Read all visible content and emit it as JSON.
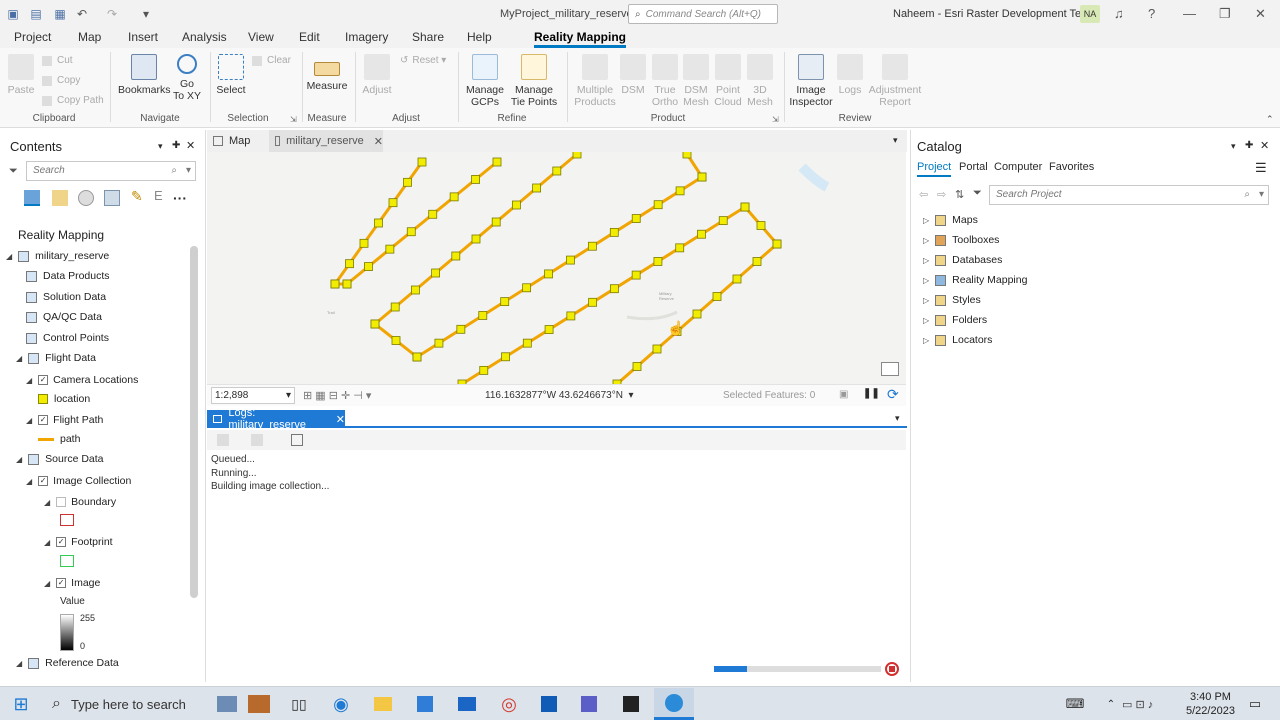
{
  "window": {
    "title": "MyProject_military_reserve",
    "command_search": "Command Search (Alt+Q)",
    "user": "Naheem - Esri Raster Development Team",
    "avatar": "NA"
  },
  "ribbon_tabs": [
    "Project",
    "Map",
    "Insert",
    "Analysis",
    "View",
    "Edit",
    "Imagery",
    "Share",
    "Help",
    "Reality Mapping"
  ],
  "ribbon": {
    "clipboard": {
      "paste": "Paste",
      "cut": "Cut",
      "copy": "Copy",
      "copy_path": "Copy Path",
      "group": "Clipboard"
    },
    "navigate": {
      "bookmarks": "Bookmarks",
      "goto": "Go",
      "goto2": "To XY",
      "group": "Navigate"
    },
    "selection": {
      "select": "Select",
      "clear": "Clear",
      "group": "Selection"
    },
    "measure": {
      "measure": "Measure",
      "group": "Measure"
    },
    "adjust": {
      "adjust": "Adjust",
      "reset": "Reset",
      "group": "Adjust"
    },
    "refine": {
      "gcps1": "Manage",
      "gcps2": "GCPs",
      "tie1": "Manage",
      "tie2": "Tie Points",
      "group": "Refine"
    },
    "product": {
      "multi1": "Multiple",
      "multi2": "Products",
      "dsm": "DSM",
      "ortho1": "True",
      "ortho2": "Ortho",
      "dsmmesh1": "DSM",
      "dsmmesh2": "Mesh",
      "pc1": "Point",
      "pc2": "Cloud",
      "mesh1": "3D",
      "mesh2": "Mesh",
      "group": "Product"
    },
    "review": {
      "inspector1": "Image",
      "inspector2": "Inspector",
      "logs": "Logs",
      "report1": "Adjustment",
      "report2": "Report",
      "group": "Review"
    }
  },
  "contents": {
    "title": "Contents",
    "search": "Search",
    "heading": "Reality Mapping",
    "items": {
      "root": "military_reserve",
      "data_products": "Data Products",
      "solution_data": "Solution Data",
      "qaqc": "QA/QC Data",
      "control_points": "Control Points",
      "flight_data": "Flight Data",
      "camera_locations": "Camera Locations",
      "location": "location",
      "flight_path": "Flight Path",
      "path": "path",
      "source_data": "Source Data",
      "image_collection": "Image Collection",
      "boundary": "Boundary",
      "footprint": "Footprint",
      "image": "Image",
      "value": "Value",
      "high": "255",
      "low": "0",
      "reference_data": "Reference Data"
    }
  },
  "map": {
    "tab_map": "Map",
    "tab_active": "military_reserve",
    "scale": "1:2,898",
    "coords": "116.1632877°W 43.6246673°N",
    "selected": "Selected Features: 0",
    "label": "Military Reserve"
  },
  "logs": {
    "tab": "Logs: military_reserve",
    "lines": [
      "Queued...",
      "Running...",
      "Building image collection..."
    ],
    "progress": 0.2
  },
  "catalog": {
    "title": "Catalog",
    "tabs": [
      "Project",
      "Portal",
      "Computer",
      "Favorites"
    ],
    "search": "Search Project",
    "items": [
      "Maps",
      "Toolboxes",
      "Databases",
      "Reality Mapping",
      "Styles",
      "Folders",
      "Locators"
    ]
  },
  "taskbar": {
    "search": "Type here to search",
    "time": "3:40 PM",
    "date": "5/22/2023"
  },
  "colors": {
    "accent": "#007ac2",
    "flight": "#f0a500",
    "point": "#f2ec00"
  }
}
